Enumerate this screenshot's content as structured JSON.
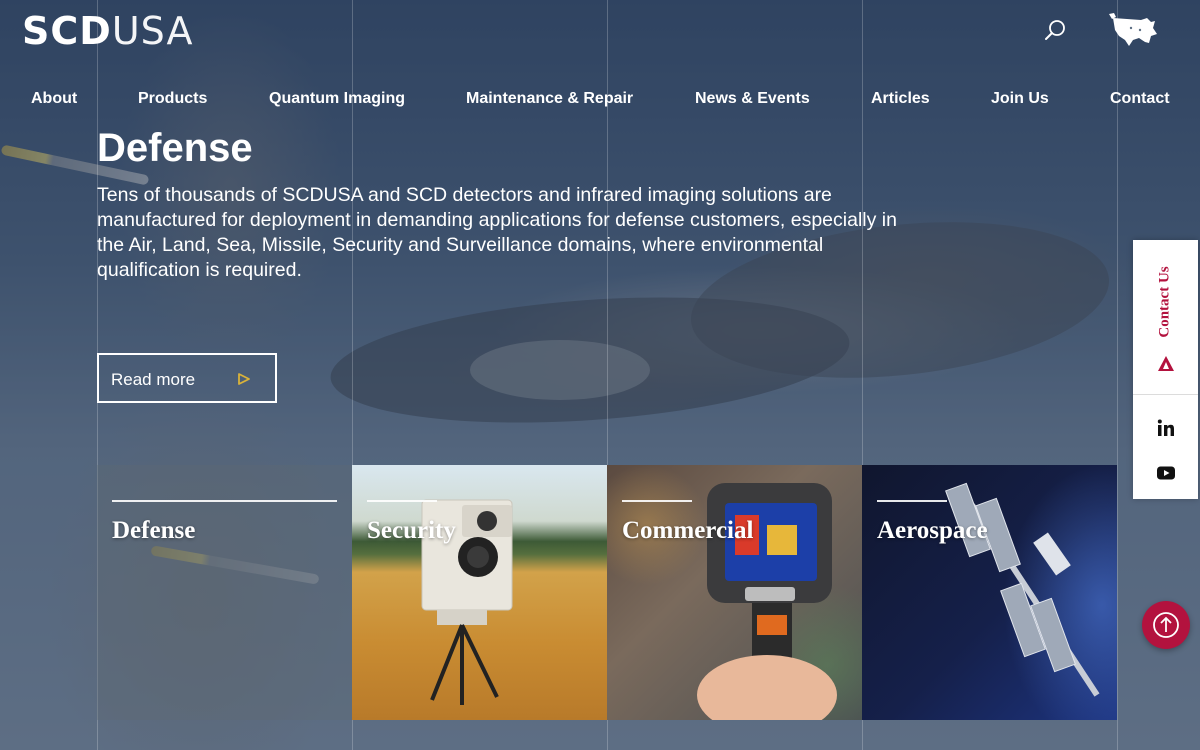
{
  "header": {
    "logo_bold": "SCD",
    "logo_thin": "USA",
    "icons": [
      "search-icon",
      "usa-map-icon"
    ]
  },
  "nav": {
    "items": [
      "About",
      "Products",
      "Quantum Imaging",
      "Maintenance & Repair",
      "News & Events",
      "Articles",
      "Join Us",
      "Contact"
    ]
  },
  "hero": {
    "title": "Defense",
    "description": "Tens of thousands of SCDUSA and SCD detectors and infrared imaging solutions are manufactured for deployment in demanding applications for defense customers, especially in the Air, Land, Sea, Missile, Security and Surveillance domains, where environmental qualification is required.",
    "read_more": "Read more",
    "read_more_icon": "play-triangle-icon"
  },
  "cards": [
    {
      "title": "Defense"
    },
    {
      "title": "Security"
    },
    {
      "title": "Commercial"
    },
    {
      "title": "Aerospace"
    }
  ],
  "side": {
    "contact_label": "Contact Us",
    "icons": [
      "contact-triangle-icon",
      "linkedin-icon",
      "youtube-icon",
      "arrow-up-icon"
    ]
  },
  "colors": {
    "accent": "#b3123e",
    "play_icon": "#d9b23a",
    "text": "#ffffff"
  }
}
